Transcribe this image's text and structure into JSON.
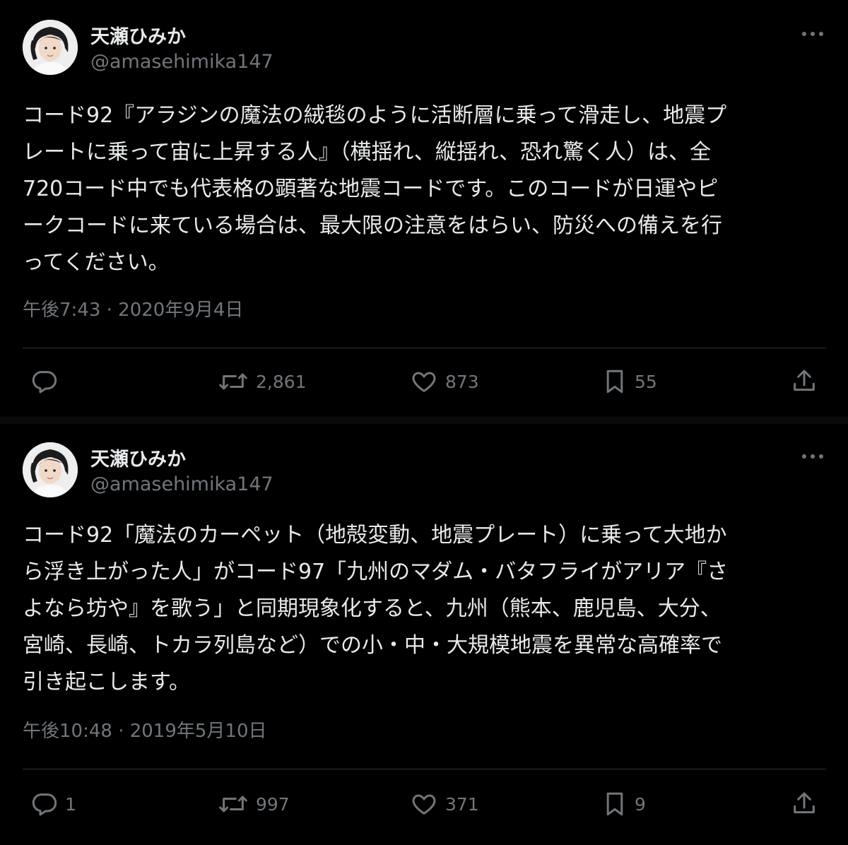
{
  "tweets": [
    {
      "author": {
        "name": "天瀬ひみか",
        "handle": "@amasehimika147"
      },
      "text": "コード92『アラジンの魔法の絨毯のように活断層に乗って滑走し、地震プ\nレートに乗って宙に上昇する人』（横揺れ、縦揺れ、恐れ驚く人）は、全\n720コード中でも代表格の顕著な地震コードです。このコードが日運やピ\nークコードに来ている場合は、最大限の注意をはらい、防災への備えを行\nってください。",
      "timestamp": "午後7:43 · 2020年9月4日",
      "actions": {
        "replies": "",
        "retweets": "2,861",
        "likes": "873",
        "bookmarks": "55"
      }
    },
    {
      "author": {
        "name": "天瀬ひみか",
        "handle": "@amasehimika147"
      },
      "text": "コード92「魔法のカーペット（地殻変動、地震プレート）に乗って大地か\nら浮き上がった人」がコード97「九州のマダム・バタフライがアリア『さ\nよなら坊や』を歌う」と同期現象化すると、九州（熊本、鹿児島、大分、\n宮崎、長崎、トカラ列島など）での小・中・大規模地震を異常な高確率で\n引き起こします。",
      "timestamp": "午後10:48 · 2019年5月10日",
      "actions": {
        "replies": "1",
        "retweets": "997",
        "likes": "371",
        "bookmarks": "9"
      }
    }
  ],
  "icons": [
    "avatar",
    "more-icon",
    "reply-icon",
    "retweet-icon",
    "like-icon",
    "bookmark-icon",
    "share-icon"
  ],
  "colors": {
    "background": "#000000",
    "text": "#e7e9ea",
    "secondary": "#71767b",
    "divider": "#2f3336"
  }
}
